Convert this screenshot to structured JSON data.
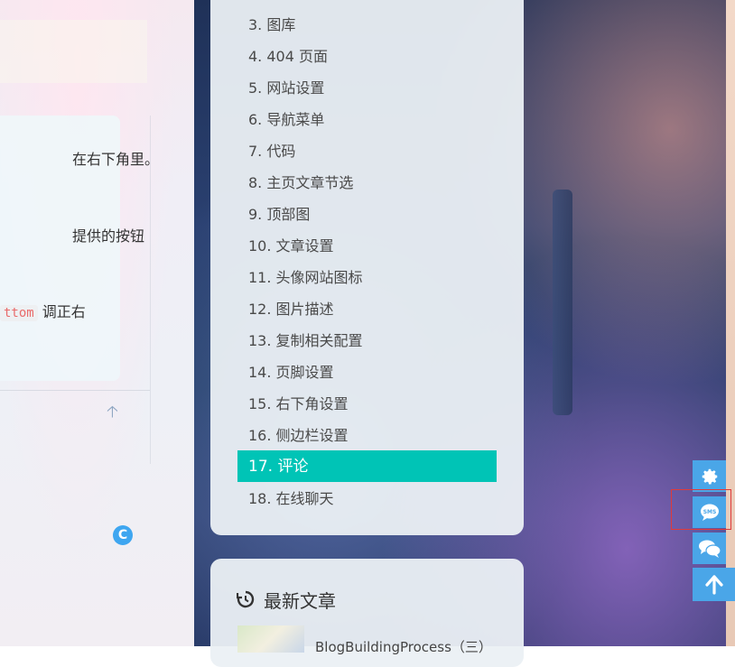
{
  "left_article": {
    "line1": "在右下角里。",
    "line2": "提供的按钮",
    "line3_code": "ttom",
    "line3_text": " 调正右",
    "avatar_letter": "C"
  },
  "toc": {
    "items": [
      {
        "label": "3. 图库"
      },
      {
        "label": "4. 404 页面"
      },
      {
        "label": "5. 网站设置"
      },
      {
        "label": "6. 导航菜单"
      },
      {
        "label": "7. 代码"
      },
      {
        "label": "8. 主页文章节选"
      },
      {
        "label": "9. 顶部图"
      },
      {
        "label": "10. 文章设置"
      },
      {
        "label": "11. 头像网站图标"
      },
      {
        "label": "12. 图片描述"
      },
      {
        "label": "13. 复制相关配置"
      },
      {
        "label": "14. 页脚设置"
      },
      {
        "label": "15. 右下角设置"
      },
      {
        "label": "16. 侧边栏设置"
      },
      {
        "label": "17. 评论"
      },
      {
        "label": "18. 在线聊天"
      }
    ],
    "active_index": 14,
    "active_color": "#00c4b6"
  },
  "recent": {
    "title": "最新文章",
    "icon": "history-icon",
    "post_title": "BlogBuildingProcess（三）"
  },
  "float_buttons": {
    "color": "#4aa6e8",
    "items": [
      "gear-icon",
      "sms-chat-icon",
      "comments-icon",
      "arrow-up-icon"
    ]
  },
  "highlight_color": "#e03a3a"
}
